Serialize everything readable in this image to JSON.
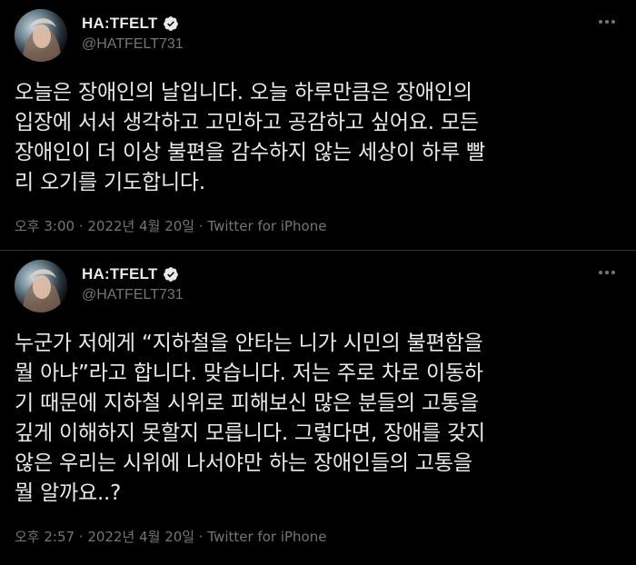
{
  "tweets": [
    {
      "display_name": "HA:TFELT",
      "handle": "@HATFELT731",
      "text": "오늘은 장애인의 날입니다. 오늘 하루만큼은 장애인의\n입장에 서서 생각하고 고민하고 공감하고 싶어요. 모든\n장애인이 더 이상 불편을 감수하지 않는 세상이 하루 빨\n리 오기를 기도합니다.",
      "timestamp": "오후 3:00 · 2022년 4월 20일 · ",
      "source": "Twitter for iPhone"
    },
    {
      "display_name": "HA:TFELT",
      "handle": "@HATFELT731",
      "text": "누군가 저에게 “지하철을 안타는 니가 시민의 불편함을\n뭘 아냐”라고 합니다. 맞습니다. 저는 주로 차로 이동하\n기 때문에 지하철 시위로 피해보신 많은 분들의 고통을\n깊게 이해하지 못할지 모릅니다. 그렇다면, 장애를 갖지\n않은 우리는 시위에 나서야만 하는 장애인들의 고통을\n뭘 알까요..?",
      "timestamp": "오후 2:57 · 2022년 4월 20일 · ",
      "source": "Twitter for iPhone"
    }
  ],
  "icons": {
    "verified": "verified-badge-icon",
    "more": "more-options-icon"
  },
  "colors": {
    "background": "#000000",
    "text": "#e7e9ea",
    "secondary": "#71767b",
    "divider": "#2f3336"
  }
}
